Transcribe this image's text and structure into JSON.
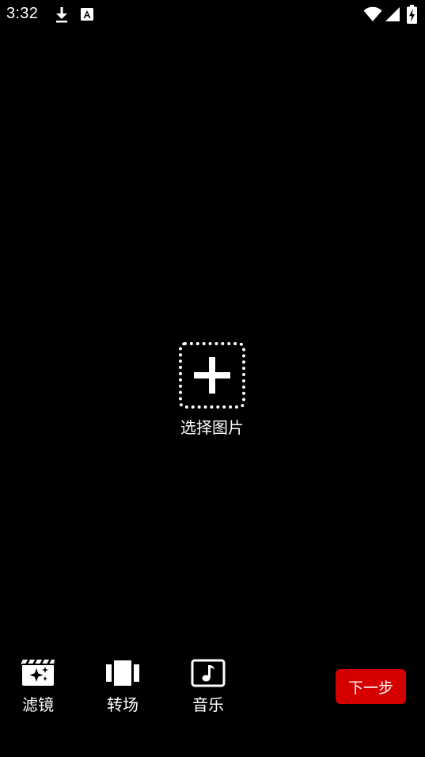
{
  "status_bar": {
    "time": "3:32",
    "icons": [
      "download-icon",
      "a-badge-icon",
      "wifi-icon",
      "signal-icon",
      "battery-charging-icon"
    ]
  },
  "picker": {
    "label": "选择图片",
    "icon": "add-icon"
  },
  "toolbar": {
    "items": [
      {
        "label": "滤镜",
        "icon": "filter-icon"
      },
      {
        "label": "转场",
        "icon": "transition-icon"
      },
      {
        "label": "音乐",
        "icon": "music-icon"
      }
    ],
    "next_label": "下一步"
  },
  "colors": {
    "background": "#000000",
    "foreground": "#ffffff",
    "accent": "#d40000"
  }
}
